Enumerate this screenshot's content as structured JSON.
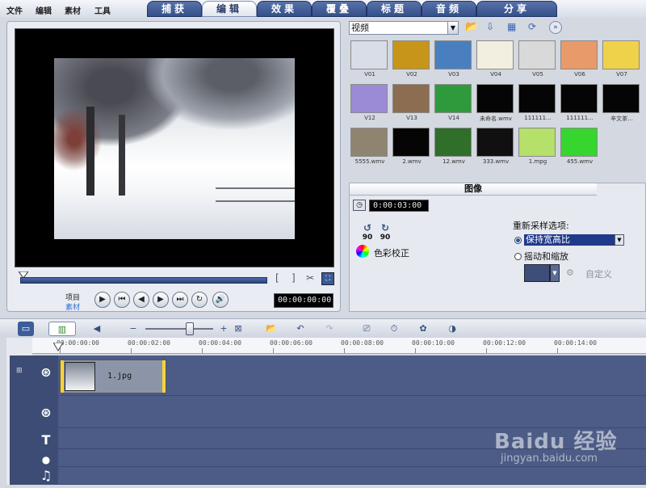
{
  "menu": [
    "文件",
    "编辑",
    "素材",
    "工具"
  ],
  "tabs": [
    {
      "label": "捕获",
      "active": false
    },
    {
      "label": "编辑",
      "active": true
    },
    {
      "label": "效果",
      "active": false
    },
    {
      "label": "覆叠",
      "active": false
    },
    {
      "label": "标题",
      "active": false
    },
    {
      "label": "音频",
      "active": false
    },
    {
      "label": "分享",
      "active": false
    }
  ],
  "player": {
    "mode_project": "项目",
    "mode_clip": "素材",
    "timecode": "00:00:00:00"
  },
  "library": {
    "dropdown": "视频",
    "thumbs": [
      {
        "caption": "V01",
        "color": "#d8dde8"
      },
      {
        "caption": "V02",
        "color": "#c7951a"
      },
      {
        "caption": "V03",
        "color": "#4a7fbf"
      },
      {
        "caption": "V04",
        "color": "#f2eee0"
      },
      {
        "caption": "V05",
        "color": "#d9d9d9"
      },
      {
        "caption": "V06",
        "color": "#e89a6a"
      },
      {
        "caption": "V07",
        "color": "#f0d24a"
      },
      {
        "caption": "V12",
        "color": "#9b8bd6"
      },
      {
        "caption": "V13",
        "color": "#8c6d52"
      },
      {
        "caption": "V14",
        "color": "#2f9a3c"
      },
      {
        "caption": "未命名.wmv",
        "color": "#050505"
      },
      {
        "caption": "111111...",
        "color": "#050505"
      },
      {
        "caption": "111111...",
        "color": "#050505"
      },
      {
        "caption": "辛文茶...",
        "color": "#050505"
      },
      {
        "caption": "5555.wmv",
        "color": "#8e8470"
      },
      {
        "caption": "2.wmv",
        "color": "#050505"
      },
      {
        "caption": "12.wmv",
        "color": "#2f6f2a"
      },
      {
        "caption": "333.wmv",
        "color": "#101010"
      },
      {
        "caption": "1.mpg",
        "color": "#b5e06a"
      },
      {
        "caption": "455.wmv",
        "color": "#36d62f"
      }
    ]
  },
  "options": {
    "tab_label": "图像",
    "duration": "0:00:03:00",
    "rotate_left": "90",
    "rotate_right": "90",
    "color_correction": "色彩校正",
    "resample_label": "重新采样选项:",
    "keep_aspect": "保持宽高比",
    "pan_zoom": "摇动和缩放",
    "custom": "自定义"
  },
  "ruler": [
    "00:00:00:00",
    "00:00:02:00",
    "00:00:04:00",
    "00:00:06:00",
    "00:00:08:00",
    "00:00:10:00",
    "00:00:12:00",
    "00:00:14:00"
  ],
  "clip": {
    "name": "1.jpg"
  },
  "watermark": {
    "brand": "Baidu 经验",
    "url": "jingyan.baidu.com"
  }
}
